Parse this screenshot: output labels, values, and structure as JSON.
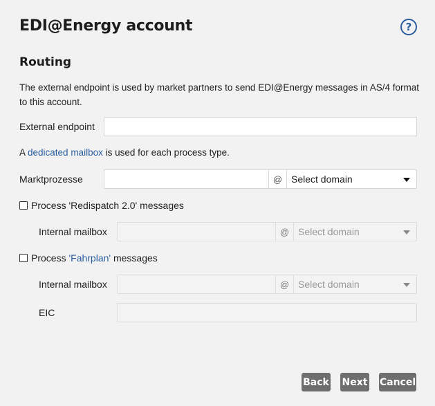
{
  "dialog": {
    "title": "EDI@Energy account",
    "help_icon": "?"
  },
  "routing": {
    "section_title": "Routing",
    "description": "The external endpoint is used by market partners to send EDI@Energy messages in AS/4 format to this account.",
    "external_endpoint_label": "External endpoint",
    "external_endpoint_value": "",
    "mailbox_note_prefix": "A ",
    "mailbox_note_link": "dedicated mailbox",
    "mailbox_note_suffix": " is used for each process type.",
    "marktprozesse_label": "Marktprozesse",
    "marktprozesse_value": "",
    "at_symbol": "@",
    "select_domain": "Select domain"
  },
  "redispatch": {
    "checkbox_label": "Process 'Redispatch 2.0' messages",
    "checked": false,
    "internal_mailbox_label": "Internal mailbox",
    "at_symbol": "@",
    "select_domain": "Select domain"
  },
  "fahrplan": {
    "checkbox_prefix": "Process ",
    "checkbox_link": "'Fahrplan'",
    "checkbox_suffix": " messages",
    "checked": false,
    "internal_mailbox_label": "Internal mailbox",
    "at_symbol": "@",
    "select_domain": "Select domain",
    "eic_label": "EIC"
  },
  "footer": {
    "back_label": "Back",
    "next_label": "Next",
    "cancel_label": "Cancel"
  },
  "colors": {
    "background": "#f2f2f2",
    "link": "#2a5d9f",
    "button": "#6e6e6e"
  }
}
